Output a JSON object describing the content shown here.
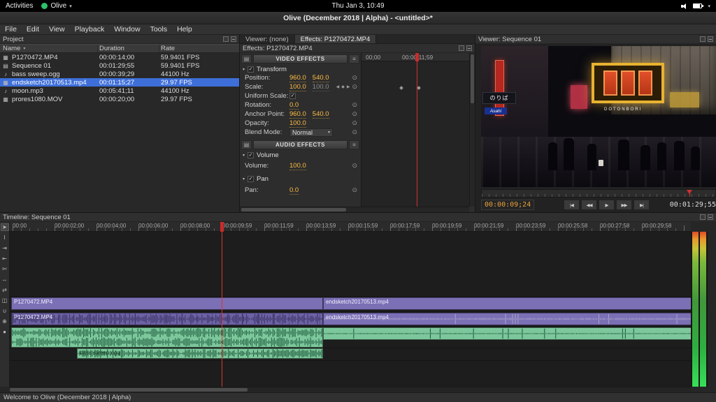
{
  "desktop": {
    "activities": "Activities",
    "app_name": "Olive",
    "clock": "Thu Jan 3, 10:49"
  },
  "window": {
    "title": "Olive (December 2018 | Alpha) - <untitled>*",
    "status": "Welcome to Olive (December 2018 | Alpha)"
  },
  "menu": {
    "items": [
      "File",
      "Edit",
      "View",
      "Playback",
      "Window",
      "Tools",
      "Help"
    ]
  },
  "project": {
    "title": "Project",
    "sort_icon": "▾",
    "columns": [
      "Name",
      "Duration",
      "Rate"
    ],
    "rows": [
      {
        "name": "P1270472.MP4",
        "type": "video",
        "duration": "00:00:14;00",
        "rate": "59.9401 FPS",
        "selected": false
      },
      {
        "name": "Sequence 01",
        "type": "sequence",
        "duration": "00:01:29;55",
        "rate": "59.9401 FPS",
        "selected": false
      },
      {
        "name": "bass sweep.ogg",
        "type": "audio",
        "duration": "00:00:39;29",
        "rate": "44100 Hz",
        "selected": false
      },
      {
        "name": "endsketch20170513.mp4",
        "type": "video",
        "duration": "00:01:15;27",
        "rate": "29.97 FPS",
        "selected": true
      },
      {
        "name": "moon.mp3",
        "type": "audio",
        "duration": "00:05:41;11",
        "rate": "44100 Hz",
        "selected": false
      },
      {
        "name": "prores1080.MOV",
        "type": "video",
        "duration": "00:00:20;00",
        "rate": "29.97 FPS",
        "selected": false
      }
    ]
  },
  "effects": {
    "tab_viewer": "Viewer: (none)",
    "tab_effects": "Effects: P1270472.MP4",
    "title": "Effects: P1270472.MP4",
    "video_header": "VIDEO EFFECTS",
    "audio_header": "AUDIO EFFECTS",
    "transform_label": "Transform",
    "position_label": "Position:",
    "position_x": "960.0",
    "position_y": "540.0",
    "scale_label": "Scale:",
    "scale_x": "100.0",
    "scale_y": "100.0",
    "uniform_label": "Uniform Scale:",
    "check_glyph": "✓",
    "rotation_label": "Rotation:",
    "rotation": "0.0",
    "anchor_label": "Anchor Point:",
    "anchor_x": "960.0",
    "anchor_y": "540.0",
    "opacity_label": "Opacity:",
    "opacity": "100.0",
    "blend_label": "Blend Mode:",
    "blend_value": "Normal",
    "volume_section": "Volume",
    "volume_label": "Volume:",
    "volume": "100.0",
    "pan_section": "Pan",
    "pan_label": "Pan:",
    "pan": "0.0",
    "kf_start": "00;00",
    "kf_end": "00:00:11;59"
  },
  "viewer": {
    "title": "Viewer: Sequence 01",
    "timecode": "00:00:09;24",
    "duration": "00:01:29;55",
    "transport": [
      {
        "name": "go-to-start-button",
        "label": "|◀"
      },
      {
        "name": "prev-frame-button",
        "label": "◀◀"
      },
      {
        "name": "play-button",
        "label": "▶"
      },
      {
        "name": "next-frame-button",
        "label": "▶▶"
      },
      {
        "name": "go-to-end-button",
        "label": "▶|"
      }
    ],
    "signs": {
      "noriba": "のりば",
      "asahi": "Asahi",
      "dotonbori": "DOTONBORI"
    }
  },
  "timeline": {
    "title": "Timeline: Sequence 01",
    "ruler": [
      "00:00",
      "00:00:02;00",
      "00:00:04;00",
      "00:00:06;00",
      "00:00:08;00",
      "00:00:09;59",
      "00:00:11;59",
      "00:00:13;59",
      "00:00:15;59",
      "00:00:17;59",
      "00:00:19;59",
      "00:00:21;59",
      "00:00:23;59",
      "00:00:25;58",
      "00:00:27;58",
      "00:00:29;58"
    ],
    "tools": [
      {
        "name": "pointer-tool",
        "glyph": "➤"
      },
      {
        "name": "edit-tool",
        "glyph": "I"
      },
      {
        "name": "ripple-tool",
        "glyph": "⇥"
      },
      {
        "name": "rolling-tool",
        "glyph": "⇤"
      },
      {
        "name": "razor-tool",
        "glyph": "✄"
      },
      {
        "name": "slip-tool",
        "glyph": "↔"
      },
      {
        "name": "slide-tool",
        "glyph": "⇄"
      },
      {
        "name": "transition-tool",
        "glyph": "◫"
      },
      {
        "name": "snapping-toggle",
        "glyph": "∪"
      },
      {
        "name": "zoom-tool",
        "glyph": "⊕"
      },
      {
        "name": "record-button",
        "glyph": "●"
      }
    ],
    "clips": {
      "v2a": "P1270472.MP4",
      "v2b": "endsketch20170513.mp4",
      "v1a": "P1270472.MP4",
      "v1b": "endsketch20170513.mp4",
      "bass": "bass sweep.ogg"
    }
  }
}
